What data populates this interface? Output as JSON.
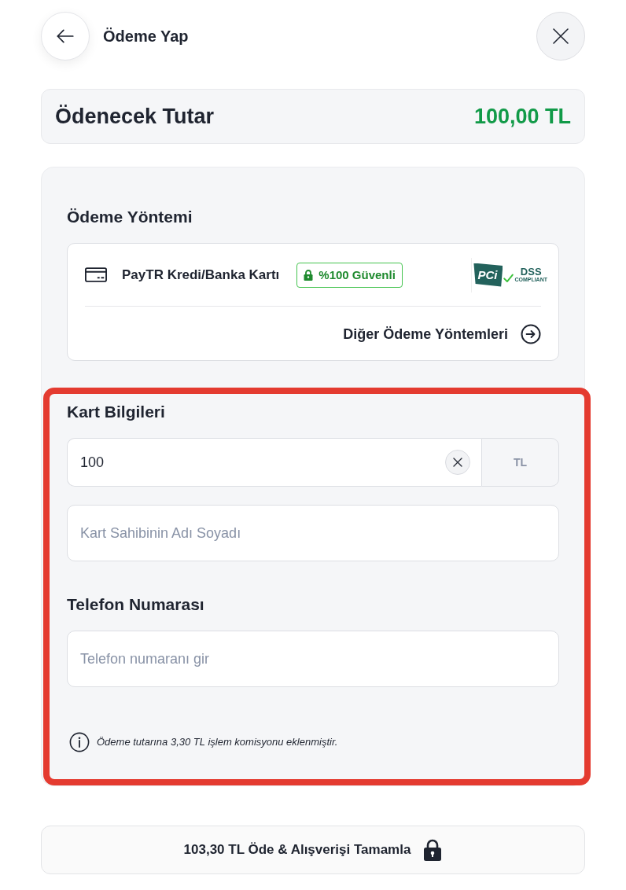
{
  "header": {
    "title": "Ödeme Yap"
  },
  "amount_summary": {
    "label": "Ödenecek Tutar",
    "value": "100,00 TL"
  },
  "payment_method": {
    "heading": "Ödeme Yöntemi",
    "method": {
      "name": "PayTR Kredi/Banka Kartı",
      "badge": "%100 Güvenli",
      "logo": {
        "mark": "PCi",
        "title": "DSS",
        "subtitle": "COMPLIANT"
      }
    },
    "other_link": "Diğer Ödeme Yöntemleri"
  },
  "details": {
    "highlighted": true,
    "sections": [
      {
        "heading": "Kart Bilgileri",
        "fields": [
          {
            "kind": "amount",
            "value": "100",
            "suffix": "TL"
          },
          {
            "kind": "text",
            "placeholder": "Kart Sahibinin Adı Soyadı"
          }
        ]
      },
      {
        "heading": "Telefon Numarası",
        "fields": [
          {
            "kind": "text",
            "placeholder": "Telefon numaranı gir"
          }
        ]
      }
    ],
    "note": "Ödeme tutarına 3,30 TL işlem komisyonu eklenmiştir."
  },
  "pay_button": {
    "label": "103,30 TL Öde & Alışverişi Tamamla"
  }
}
